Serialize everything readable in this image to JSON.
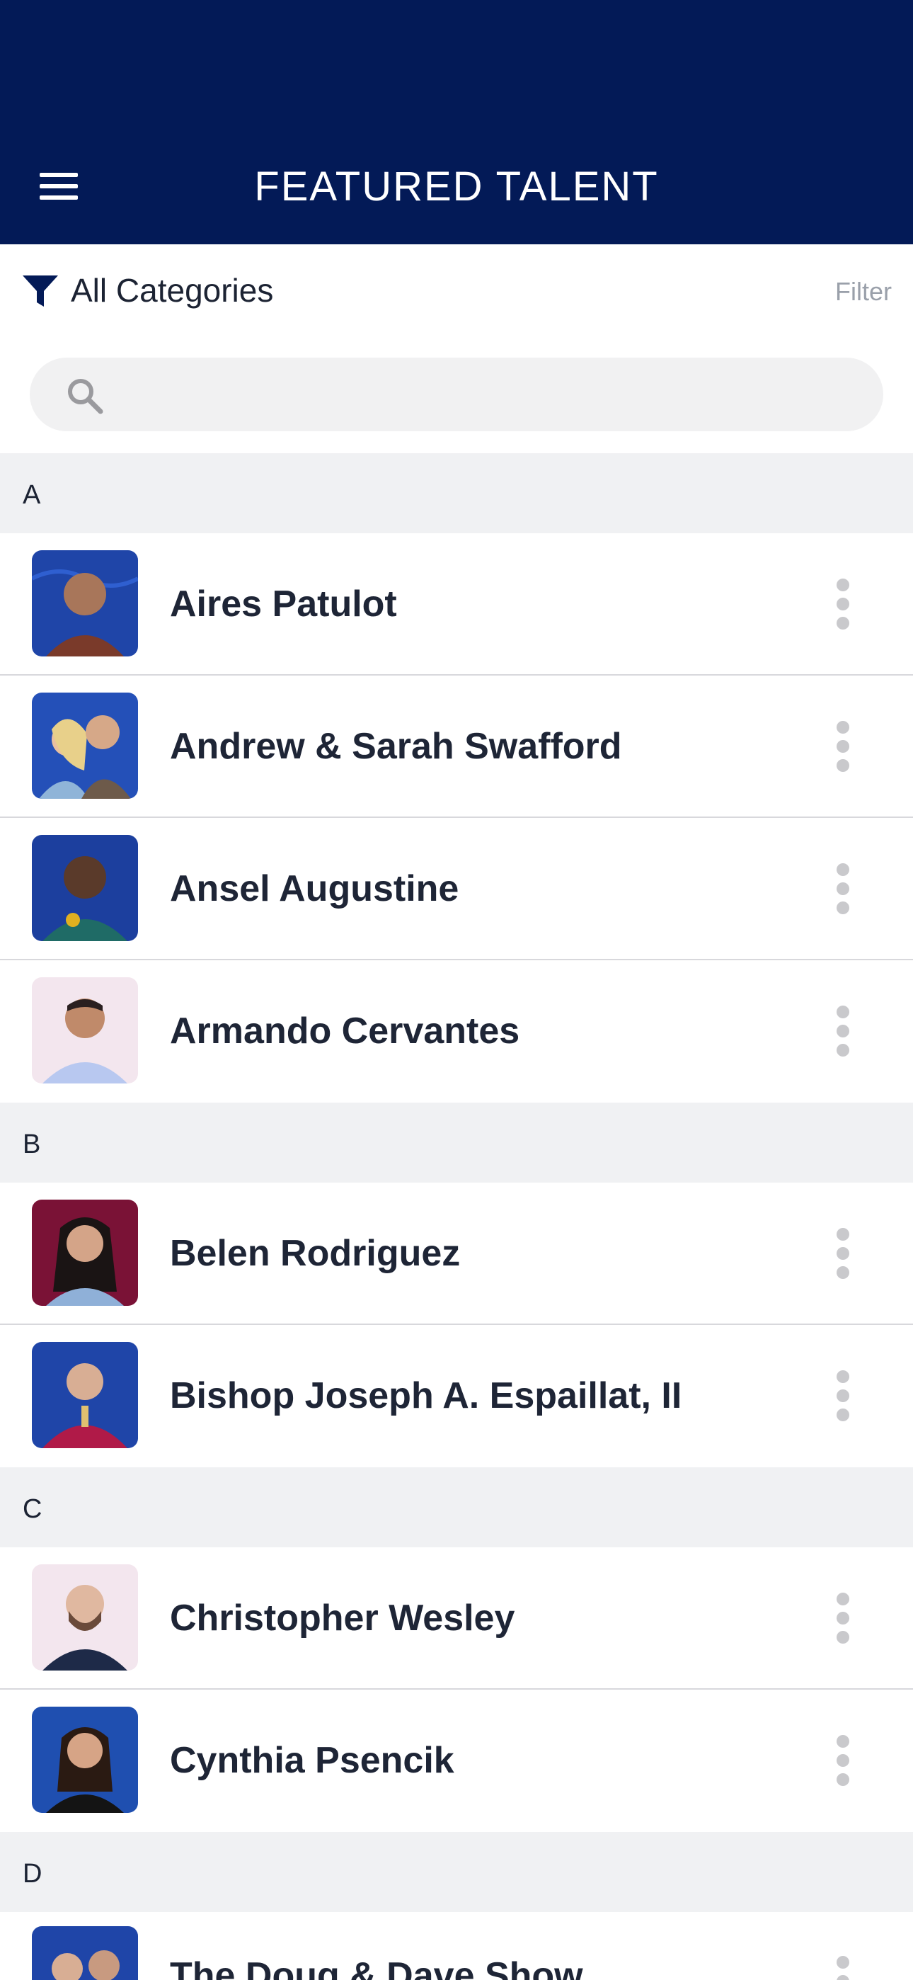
{
  "header": {
    "title": "FEATURED TALENT",
    "background": "#031a57"
  },
  "filter": {
    "label": "All Categories",
    "button_label": "Filter"
  },
  "search": {
    "placeholder": "",
    "value": ""
  },
  "sections": [
    {
      "letter": "A",
      "items": [
        {
          "name": "Aires Patulot",
          "avatar_bg": "#1f45a8"
        },
        {
          "name": "Andrew & Sarah Swafford",
          "avatar_bg": "#2450b8"
        },
        {
          "name": "Ansel Augustine",
          "avatar_bg": "#1c3f9e"
        },
        {
          "name": "Armando Cervantes",
          "avatar_bg": "#f3e6ee"
        }
      ]
    },
    {
      "letter": "B",
      "items": [
        {
          "name": "Belen Rodriguez",
          "avatar_bg": "#7a1236"
        },
        {
          "name": "Bishop Joseph A. Espaillat, II",
          "avatar_bg": "#1f45a8"
        }
      ]
    },
    {
      "letter": "C",
      "items": [
        {
          "name": "Christopher Wesley",
          "avatar_bg": "#f3e6ee"
        },
        {
          "name": "Cynthia Psencik",
          "avatar_bg": "#1f4fb0"
        }
      ]
    },
    {
      "letter": "D",
      "items": [
        {
          "name": "The Doug & Dave Show",
          "avatar_bg": "#1f45a8"
        }
      ]
    }
  ],
  "icons": {
    "menu": "hamburger-menu-icon",
    "filter": "funnel-icon",
    "search": "magnifier-icon",
    "more": "vertical-ellipsis-icon"
  },
  "colors": {
    "accent": "#031a57",
    "section_bg": "#f0f1f3",
    "divider": "#d8d8dc",
    "muted": "#9aa0aa"
  }
}
